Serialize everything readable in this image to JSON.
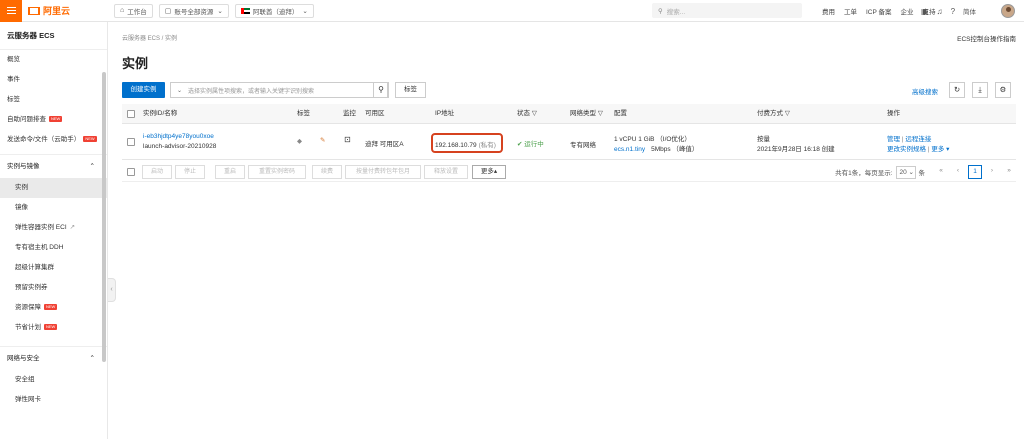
{
  "topbar": {
    "logo_text": "阿里云",
    "workbench": "工作台",
    "account_scope": "账号全部资源",
    "region": "阿联酋（迪拜）",
    "search_placeholder": "搜索...",
    "links": [
      "费用",
      "工单",
      "ICP 备案",
      "企业",
      "支持"
    ],
    "lang": "简体"
  },
  "sidebar": {
    "title": "云服务器 ECS",
    "items_top": [
      {
        "label": "概览"
      },
      {
        "label": "事件"
      },
      {
        "label": "标签"
      },
      {
        "label": "自助问题排查",
        "badge": "NEW"
      },
      {
        "label": "发送命令/文件（云助手）",
        "badge": "NEW"
      }
    ],
    "group1": "实例与镜像",
    "group1_items": [
      {
        "label": "实例",
        "active": true
      },
      {
        "label": "镜像"
      },
      {
        "label": "弹性容器实例 ECI"
      },
      {
        "label": "专有宿主机 DDH"
      },
      {
        "label": "超级计算集群"
      },
      {
        "label": "预留实例券"
      },
      {
        "label": "资源保障",
        "badge": "NEW"
      },
      {
        "label": "节省计划",
        "badge": "NEW"
      }
    ],
    "group2": "网络与安全",
    "group2_items": [
      {
        "label": "安全组"
      },
      {
        "label": "弹性网卡"
      }
    ]
  },
  "main": {
    "breadcrumb": "云服务器 ECS / 实例",
    "guide": "ECS控制台操作指南",
    "title": "实例",
    "create_btn": "创建实例",
    "filter_placeholder": "选择实例属性项搜索，或者输入关键字识别搜索",
    "tag_btn": "标签",
    "adv_search": "高级搜索"
  },
  "table": {
    "headers": {
      "id": "实例ID/名称",
      "tag": "标签",
      "monitor": "监控",
      "zone": "可用区",
      "ip": "IP地址",
      "status": "状态",
      "net": "网络类型",
      "config": "配置",
      "pay": "付费方式",
      "ops": "操作"
    },
    "row": {
      "id": "i-eb3hjdtp4ye78you0xoe",
      "name": "launch-advisor-20210928",
      "zone": "迪拜 可用区A",
      "ip": "192.168.10.79",
      "ip_type": "(私有)",
      "status": "运行中",
      "net": "专有网络",
      "config_line1": "1 vCPU 1 GiB （I/O优化）",
      "config_spec": "ecs.n1.tiny",
      "config_bw": "5Mbps （峰值）",
      "pay_type": "按量",
      "pay_created": "2021年9月28日 16:18 创建",
      "op_manage": "管理",
      "op_remote": "远程连接",
      "op_change": "更改实例规格",
      "op_more": "更多"
    }
  },
  "batch": {
    "buttons": [
      "启动",
      "停止",
      "重启",
      "重置实例密码",
      "续费",
      "按量付费转包年包月",
      "释放设置"
    ],
    "more": "更多"
  },
  "pager": {
    "summary": "共有1条，每页显示:",
    "size": "20",
    "page": "1"
  }
}
